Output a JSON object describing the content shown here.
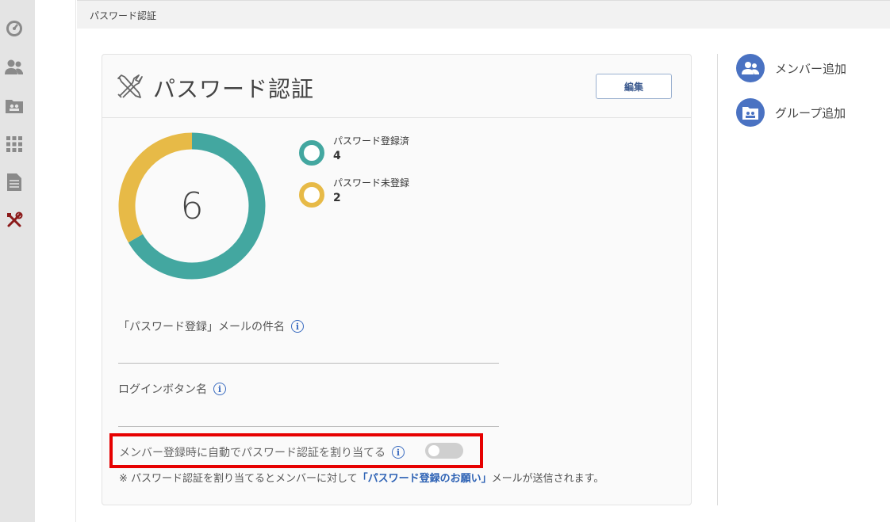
{
  "breadcrumb": "パスワード認証",
  "sidebar": {
    "items": [
      {
        "icon": "dashboard-icon"
      },
      {
        "icon": "users-icon"
      },
      {
        "icon": "group-folder-icon"
      },
      {
        "icon": "apps-grid-icon"
      },
      {
        "icon": "document-icon"
      },
      {
        "icon": "tools-icon",
        "active": true
      }
    ]
  },
  "card": {
    "title": "パスワード認証",
    "edit_label": "編集"
  },
  "chart_data": {
    "type": "pie",
    "total": "6",
    "series": [
      {
        "name": "パスワード登録済",
        "value": 4,
        "color": "#43a7a0"
      },
      {
        "name": "パスワード未登録",
        "value": 2,
        "color": "#e7ba47"
      }
    ]
  },
  "fields": {
    "mail_subject_label": "「パスワード登録」メールの件名",
    "mail_subject_value": "",
    "login_button_label": "ログインボタン名",
    "login_button_value": ""
  },
  "auto_assign": {
    "label": "メンバー登録時に自動でパスワード認証を割り当てる",
    "enabled": false,
    "note_prefix": "※ パスワード認証を割り当てるとメンバーに対して",
    "note_link": "「パスワード登録のお願い」",
    "note_suffix": "メールが送信されます。"
  },
  "actions": {
    "add_member": "メンバー追加",
    "add_group": "グループ追加"
  },
  "colors": {
    "accent_blue": "#4a72c2",
    "teal": "#43a7a0",
    "yellow": "#e7ba47",
    "highlight_red": "#e60000",
    "active_tool": "#8b1a1a"
  }
}
